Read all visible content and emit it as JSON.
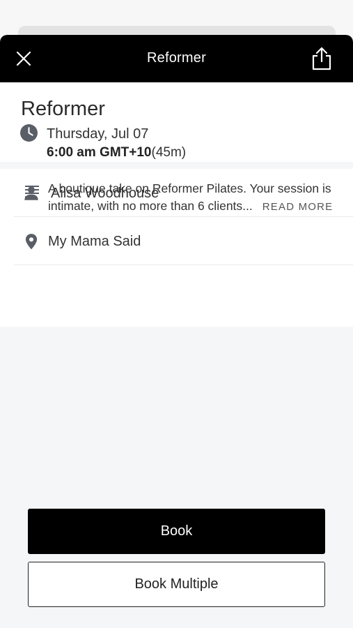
{
  "header": {
    "title": "Reformer"
  },
  "class": {
    "title": "Reformer",
    "date": "Thursday, Jul 07",
    "time": "6:00 am GMT+10",
    "duration": "(45m)"
  },
  "details": {
    "instructor": "Ailsa Woodhouse",
    "location": "My Mama Said",
    "description": "A boutique take on Reformer Pilates. Your session is intimate, with no more than 6 clients...",
    "read_more": "READ MORE"
  },
  "actions": {
    "book": "Book",
    "book_multiple": "Book Multiple"
  },
  "icons": {
    "close": "close-icon",
    "share": "share-icon",
    "clock": "clock-icon",
    "person": "person-icon",
    "location": "location-pin-icon",
    "description": "description-lines-icon"
  },
  "colors": {
    "header_bg": "#000000",
    "primary_button": "#000000",
    "background": "#f5f6f8"
  }
}
